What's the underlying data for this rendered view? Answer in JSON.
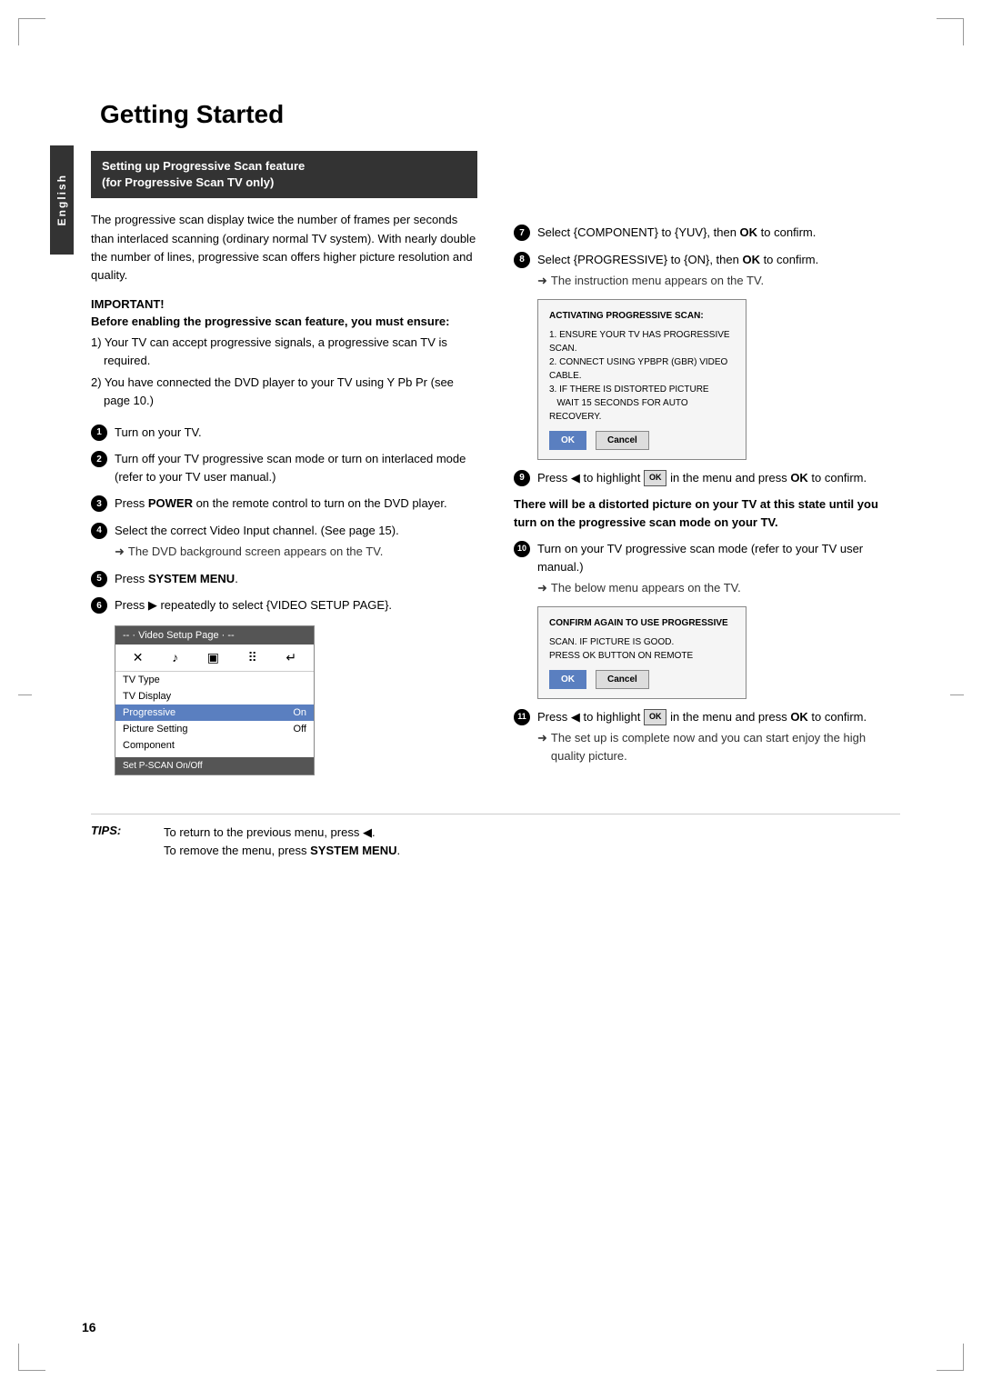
{
  "page": {
    "title": "Getting Started",
    "number": "16",
    "sidebar_label": "English"
  },
  "section": {
    "heading_line1": "Setting up Progressive Scan feature",
    "heading_line2": "(for Progressive Scan TV only)"
  },
  "intro": {
    "text": "The progressive scan display twice the number of frames per seconds than interlaced scanning (ordinary normal TV system). With nearly double the number of lines, progressive scan offers higher picture resolution and quality."
  },
  "important": {
    "label": "IMPORTANT!",
    "subheading": "Before enabling the progressive scan feature, you must ensure:",
    "bullets": [
      "1) Your TV can accept progressive signals, a progressive scan TV is required.",
      "2) You have connected the DVD player to your TV using Y Pb Pr (see page 10.)"
    ]
  },
  "steps_left": [
    {
      "num": "1",
      "text": "Turn on your TV."
    },
    {
      "num": "2",
      "text": "Turn off your TV progressive scan mode or turn on interlaced mode (refer to your TV user manual.)"
    },
    {
      "num": "3",
      "text": "Press POWER on the remote control to turn on the DVD player."
    },
    {
      "num": "4",
      "text": "Select the correct Video Input channel. (See page 15).",
      "arrow_note": "The DVD background screen appears on the TV."
    },
    {
      "num": "5",
      "text": "Press SYSTEM MENU."
    },
    {
      "num": "6",
      "text": "Press ▶ repeatedly to select {VIDEO SETUP PAGE}."
    }
  ],
  "menu_box": {
    "header": "-- · Video Setup Page · --",
    "icons": [
      "✕",
      "♪",
      "▣",
      "⠿",
      "↵"
    ],
    "items": [
      {
        "label": "TV Type",
        "value": "",
        "highlighted": false
      },
      {
        "label": "TV Display",
        "value": "",
        "highlighted": false
      },
      {
        "label": "Progressive",
        "value": "On",
        "highlighted": true
      },
      {
        "label": "Picture Setting",
        "value": "Off",
        "highlighted": false
      },
      {
        "label": "Component",
        "value": "",
        "highlighted": false
      }
    ],
    "footer": "Set P-SCAN On/Off"
  },
  "steps_right": [
    {
      "num": "7",
      "text": "Select {COMPONENT} to {YUV}, then OK to confirm."
    },
    {
      "num": "8",
      "text": "Select {PROGRESSIVE} to {ON}, then OK to confirm.",
      "arrow_note": "The instruction menu appears on the TV."
    },
    {
      "screen1": {
        "title": "ACTIVATING PROGRESSIVE SCAN:",
        "lines": [
          "1. ENSURE YOUR TV HAS PROGRESSIVE SCAN.",
          "2. CONNECT USING YPBPR (GBR) VIDEO CABLE.",
          "3. IF THERE IS DISTORTED PICTURE",
          "   WAIT 15 SECONDS FOR AUTO RECOVERY."
        ],
        "btn_ok": "OK",
        "btn_cancel": "Cancel"
      }
    },
    {
      "num": "9",
      "text": "Press ◀ to highlight  OK  in the menu and press OK to confirm."
    },
    {
      "bold_note": "There will be a distorted picture on your TV at this state until you turn on the progressive scan mode on your TV."
    },
    {
      "num": "10",
      "text": "Turn on your TV progressive scan mode (refer to your TV user manual.)",
      "arrow_note": "The below menu appears on the TV."
    },
    {
      "screen2": {
        "title": "CONFIRM AGAIN TO USE PROGRESSIVE",
        "lines": [
          "SCAN. IF PICTURE IS GOOD.",
          "PRESS OK BUTTON ON REMOTE"
        ],
        "btn_ok": "OK",
        "btn_cancel": "Cancel"
      }
    },
    {
      "num": "11",
      "text": "Press ◀ to highlight  OK  in the menu and press OK to confirm.",
      "arrow_note": "The set up is complete now and you can start enjoy the high quality picture."
    }
  ],
  "tips": {
    "label": "TIPS:",
    "line1": "To return to the previous menu, press ◀.",
    "line2": "To remove the menu, press SYSTEM MENU."
  }
}
